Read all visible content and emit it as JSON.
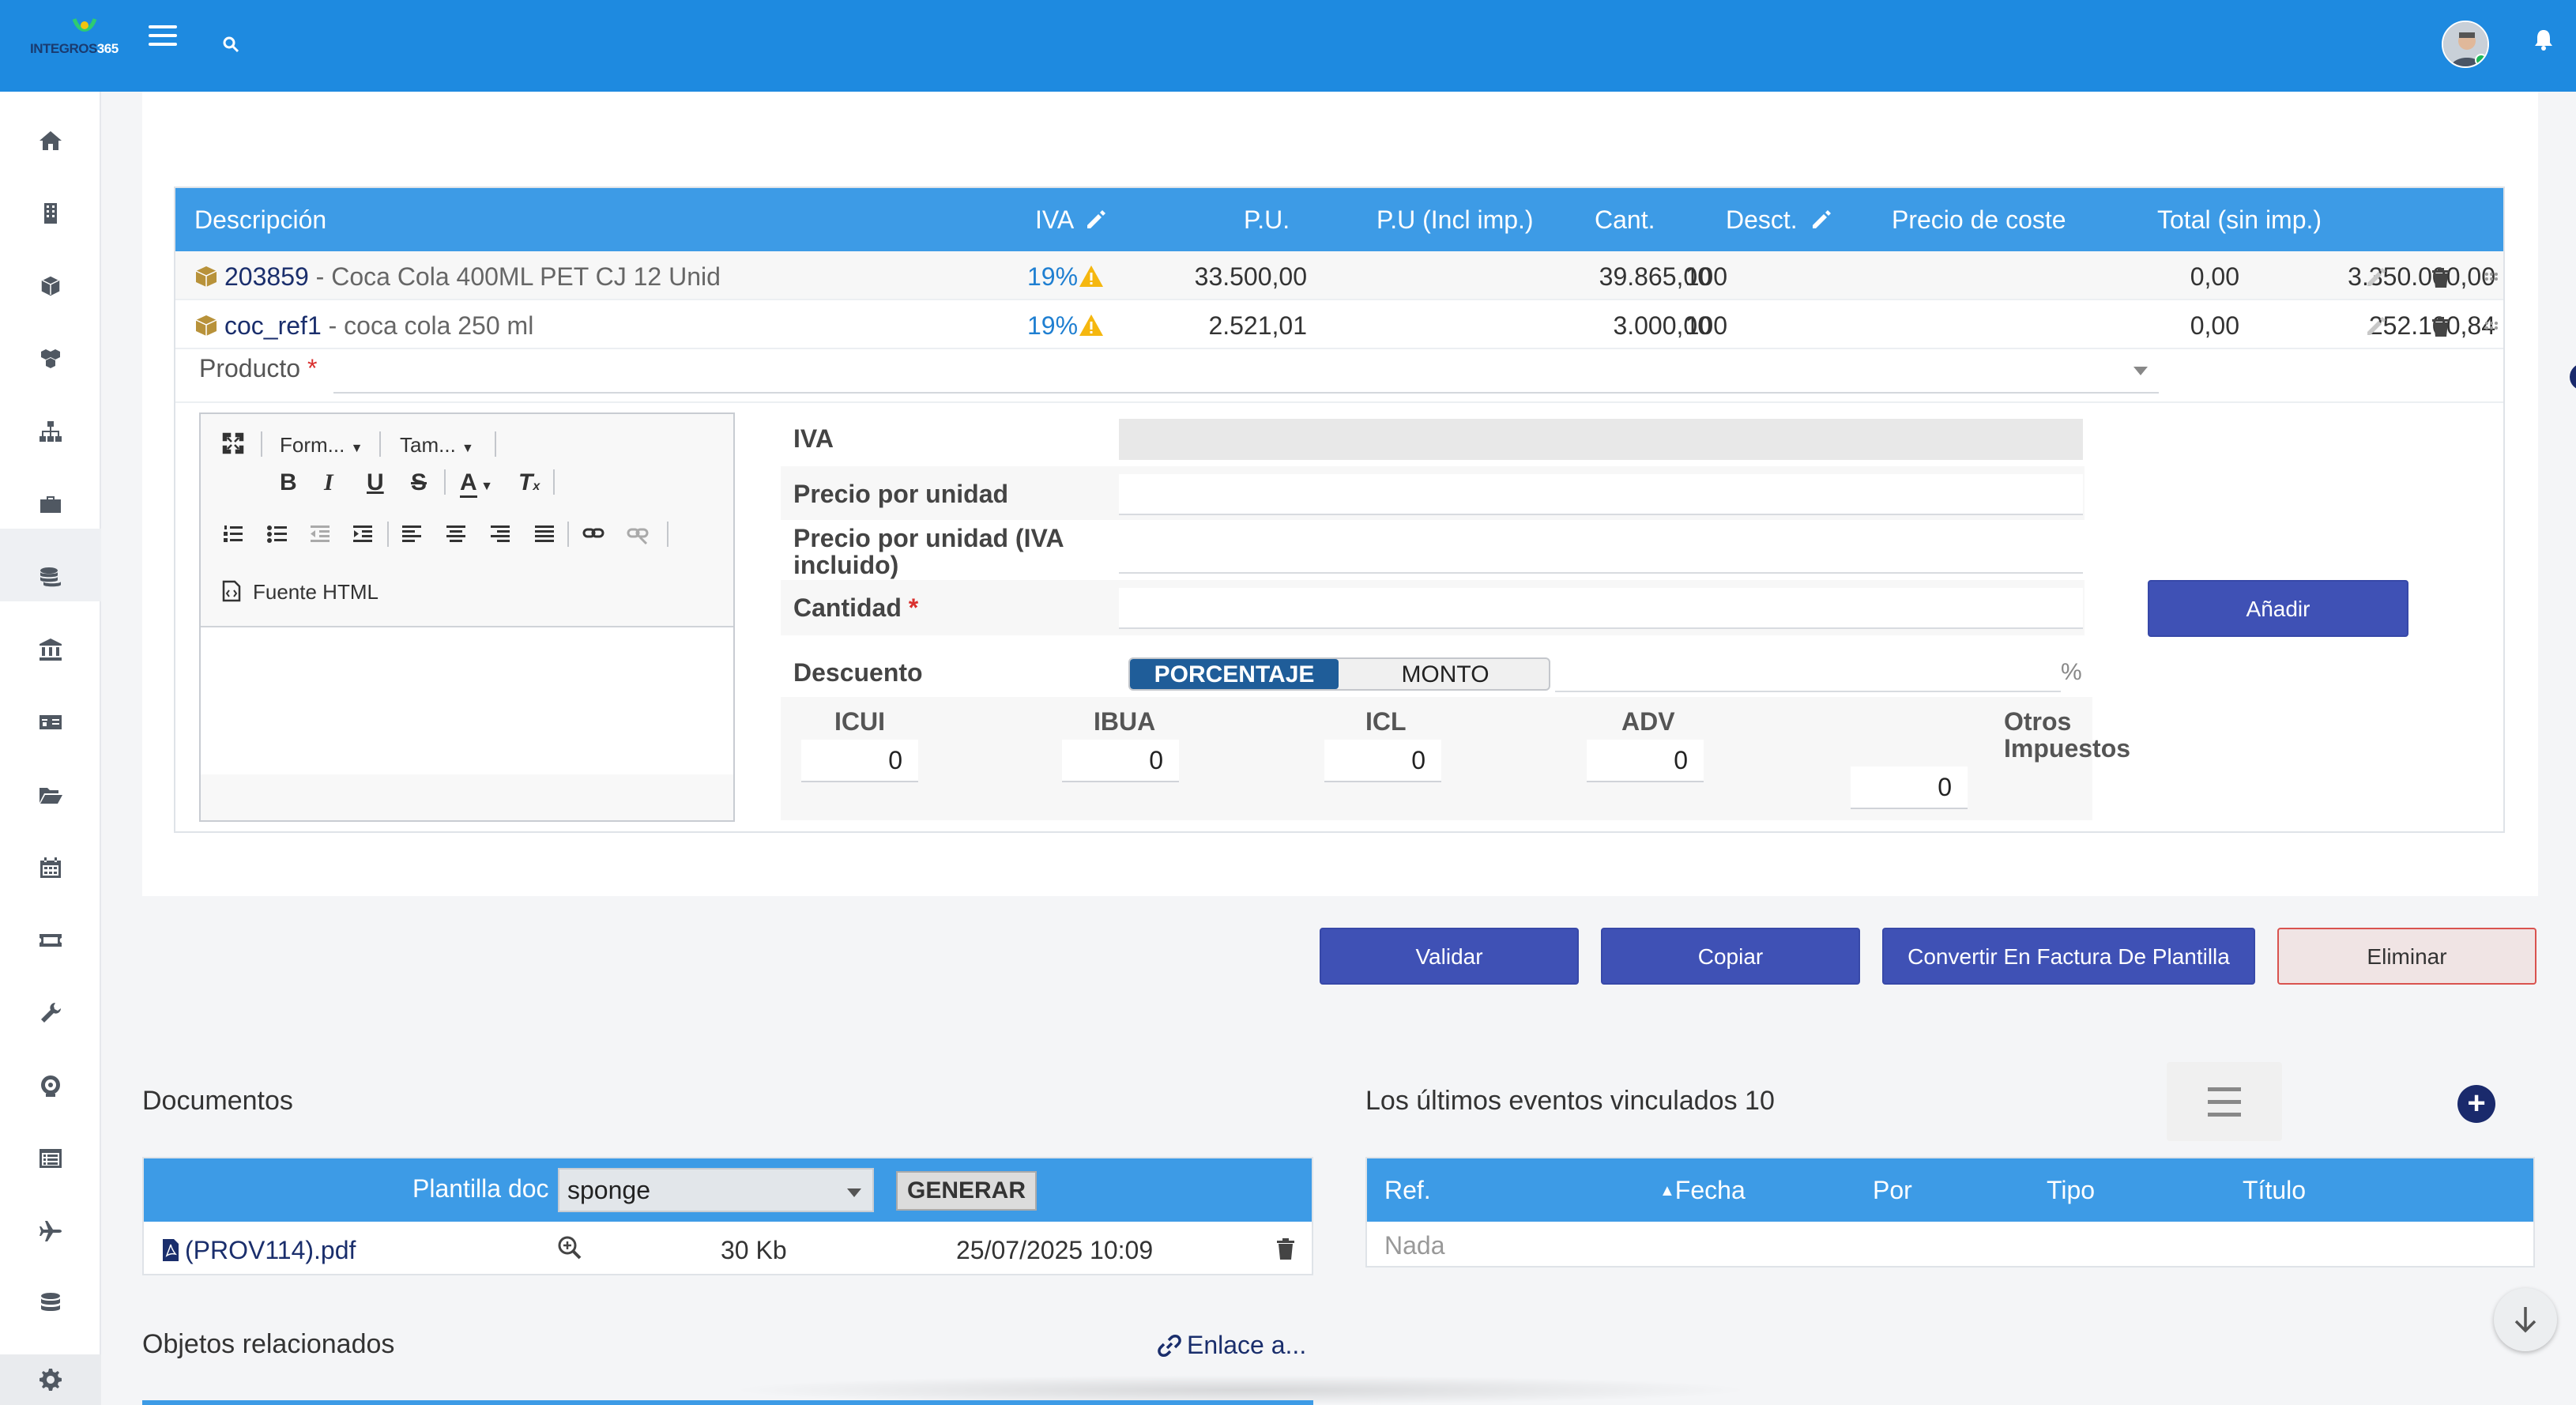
{
  "app": {
    "logo_text": "INTEGROS",
    "logo_suffix": "365"
  },
  "colors": {
    "topbar": "#1e8ae0",
    "table_header": "#3d9be6",
    "primary_button": "#3f51b5",
    "danger_border": "#d9534f",
    "ref_link": "#1a2e6c"
  },
  "sidebar": {
    "items": [
      {
        "icon": "home-icon"
      },
      {
        "icon": "building-icon"
      },
      {
        "icon": "cube-icon"
      },
      {
        "icon": "cubes-icon"
      },
      {
        "icon": "sitemap-icon"
      },
      {
        "icon": "briefcase-icon"
      },
      {
        "icon": "coins-icon"
      },
      {
        "icon": "bank-icon"
      },
      {
        "icon": "money-card-icon"
      },
      {
        "icon": "folder-open-icon"
      },
      {
        "icon": "calendar-icon"
      },
      {
        "icon": "ticket-icon"
      },
      {
        "icon": "wrench-icon"
      },
      {
        "icon": "target-icon"
      },
      {
        "icon": "list-alt-icon"
      },
      {
        "icon": "plane-icon"
      },
      {
        "icon": "database-icon"
      },
      {
        "icon": "gear-icon"
      }
    ]
  },
  "lines_table": {
    "headers": {
      "descripcion": "Descripción",
      "iva": "IVA",
      "pu": "P.U.",
      "pu_incl": "P.U (Incl imp.)",
      "cant": "Cant.",
      "desct": "Desct.",
      "precio_coste": "Precio de coste",
      "total": "Total (sin imp.)"
    },
    "rows": [
      {
        "ref": "203859",
        "desc": " - Coca Cola 400ML PET CJ 12 Unid",
        "iva": "19%",
        "pu": "33.500,00",
        "pu_incl": "39.865,00",
        "cant": "100",
        "desct": "",
        "precio_coste": "0,00",
        "total": "3.350.000,00"
      },
      {
        "ref": "coc_ref1",
        "desc": " - coca cola 250 ml",
        "iva": "19%",
        "pu": "2.521,01",
        "pu_incl": "3.000,00",
        "cant": "100",
        "desct": "",
        "precio_coste": "0,00",
        "total": "252.100,84"
      }
    ],
    "producto_label": "Producto",
    "required_mark": "*"
  },
  "editor": {
    "format_label": "Form...",
    "size_label": "Tam...",
    "source_label": "Fuente HTML"
  },
  "line_form": {
    "iva_label": "IVA",
    "precio_unidad_label": "Precio por unidad",
    "precio_unidad_iva_label_1": "Precio por unidad (IVA",
    "precio_unidad_iva_label_2": "incluido)",
    "cantidad_label": "Cantidad",
    "descuento_label": "Descuento",
    "porcentaje": "PORCENTAJE",
    "monto": "MONTO",
    "pct_symbol": "%",
    "taxes": [
      {
        "label": "ICUI",
        "value": "0"
      },
      {
        "label": "IBUA",
        "value": "0"
      },
      {
        "label": "ICL",
        "value": "0"
      },
      {
        "label": "ADV",
        "value": "0"
      }
    ],
    "otros_label_1": "Otros",
    "otros_label_2": "Impuestos",
    "otros_value": "0",
    "add_button": "Añadir"
  },
  "actions": {
    "validar": "Validar",
    "copiar": "Copiar",
    "convertir": "Convertir En Factura De Plantilla",
    "eliminar": "Eliminar"
  },
  "documents": {
    "title": "Documentos",
    "plantilla_label": "Plantilla doc",
    "plantilla_value": "sponge",
    "generar": "GENERAR",
    "file_name": "(PROV114).pdf",
    "file_size": "30 Kb",
    "file_date": "25/07/2025 10:09"
  },
  "events": {
    "title": "Los últimos eventos vinculados 10",
    "headers": {
      "ref": "Ref.",
      "fecha": "Fecha",
      "por": "Por",
      "tipo": "Tipo",
      "titulo": "Título"
    },
    "empty": "Nada"
  },
  "related": {
    "title": "Objetos relacionados",
    "link_label": "Enlace a..."
  }
}
